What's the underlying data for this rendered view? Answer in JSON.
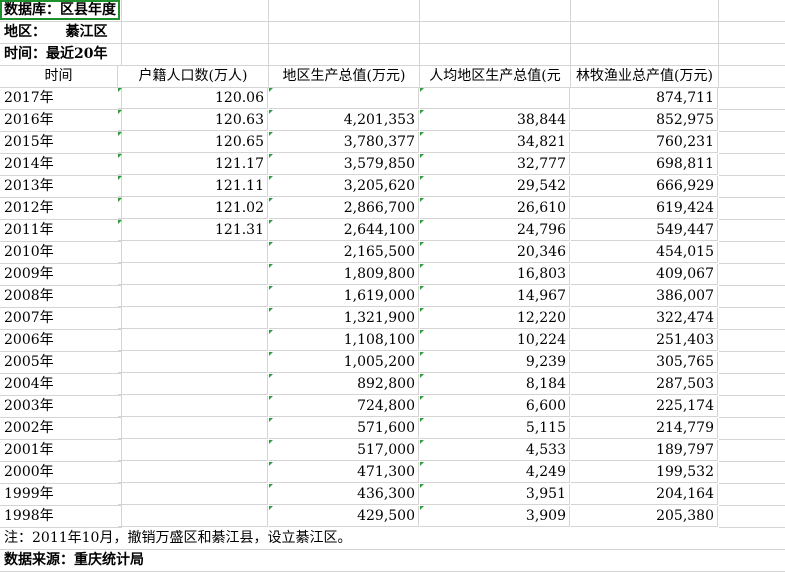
{
  "meta": {
    "database": "数据库：区县年度",
    "region": "地区：    綦江区",
    "period": "时间：最近20年"
  },
  "columns": [
    "时间",
    "户籍人口数(万人)",
    "地区生产总值(万元)",
    "人均地区生产总值(元",
    "林牧渔业总产值(万元)"
  ],
  "rows": [
    {
      "year": "2017年",
      "pop": "120.06",
      "gdp": "",
      "pcgdp": "",
      "agri": "874,711"
    },
    {
      "year": "2016年",
      "pop": "120.63",
      "gdp": "4,201,353",
      "pcgdp": "38,844",
      "agri": "852,975"
    },
    {
      "year": "2015年",
      "pop": "120.65",
      "gdp": "3,780,377",
      "pcgdp": "34,821",
      "agri": "760,231"
    },
    {
      "year": "2014年",
      "pop": "121.17",
      "gdp": "3,579,850",
      "pcgdp": "32,777",
      "agri": "698,811"
    },
    {
      "year": "2013年",
      "pop": "121.11",
      "gdp": "3,205,620",
      "pcgdp": "29,542",
      "agri": "666,929"
    },
    {
      "year": "2012年",
      "pop": "121.02",
      "gdp": "2,866,700",
      "pcgdp": "26,610",
      "agri": "619,424"
    },
    {
      "year": "2011年",
      "pop": "121.31",
      "gdp": "2,644,100",
      "pcgdp": "24,796",
      "agri": "549,447"
    },
    {
      "year": "2010年",
      "pop": "",
      "gdp": "2,165,500",
      "pcgdp": "20,346",
      "agri": "454,015"
    },
    {
      "year": "2009年",
      "pop": "",
      "gdp": "1,809,800",
      "pcgdp": "16,803",
      "agri": "409,067"
    },
    {
      "year": "2008年",
      "pop": "",
      "gdp": "1,619,000",
      "pcgdp": "14,967",
      "agri": "386,007"
    },
    {
      "year": "2007年",
      "pop": "",
      "gdp": "1,321,900",
      "pcgdp": "12,220",
      "agri": "322,474"
    },
    {
      "year": "2006年",
      "pop": "",
      "gdp": "1,108,100",
      "pcgdp": "10,224",
      "agri": "251,403"
    },
    {
      "year": "2005年",
      "pop": "",
      "gdp": "1,005,200",
      "pcgdp": "9,239",
      "agri": "305,765"
    },
    {
      "year": "2004年",
      "pop": "",
      "gdp": "892,800",
      "pcgdp": "8,184",
      "agri": "287,503"
    },
    {
      "year": "2003年",
      "pop": "",
      "gdp": "724,800",
      "pcgdp": "6,600",
      "agri": "225,174"
    },
    {
      "year": "2002年",
      "pop": "",
      "gdp": "571,600",
      "pcgdp": "5,115",
      "agri": "214,779"
    },
    {
      "year": "2001年",
      "pop": "",
      "gdp": "517,000",
      "pcgdp": "4,533",
      "agri": "189,797"
    },
    {
      "year": "2000年",
      "pop": "",
      "gdp": "471,300",
      "pcgdp": "4,249",
      "agri": "199,532"
    },
    {
      "year": "1999年",
      "pop": "",
      "gdp": "436,300",
      "pcgdp": "3,951",
      "agri": "204,164"
    },
    {
      "year": "1998年",
      "pop": "",
      "gdp": "429,500",
      "pcgdp": "3,909",
      "agri": "205,380"
    }
  ],
  "note": "注：2011年10月，撤销万盛区和綦江县，设立綦江区。",
  "source": "数据来源：重庆统计局"
}
